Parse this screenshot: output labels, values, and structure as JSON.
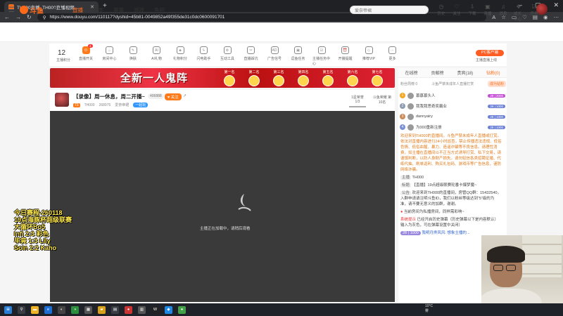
{
  "browser": {
    "tab_title": "TH000直播_TH000直播视频...",
    "url": "https://www.douyu.com/110117?dyshid=45b81-0049852a49f355de31c0dc0600091701"
  },
  "site": {
    "logo_text": "斗鱼",
    "nav": [
      "首页",
      "直播",
      "分类",
      "赛事",
      "游戏",
      "鱼吧"
    ],
    "search_placeholder": "爱奈帝裙",
    "header_icons": [
      "历史",
      "关注",
      "下载",
      "开播",
      "消息",
      "成长中心",
      "任务"
    ]
  },
  "toolbar": {
    "count": "12",
    "count_label": "主播积分",
    "items": [
      "直播开关",
      "房间中心",
      "换肤",
      "AI礼物",
      "礼物积分",
      "闪电助手",
      "互动工具",
      "直播踩坑",
      "广告信号",
      "逗鱼任务",
      "主播任务中心",
      "开播提醒",
      "推荐VIP",
      "更多"
    ],
    "badge": "4",
    "pc_button": "PC客户端",
    "pc_sub": "主播直播上线"
  },
  "banner": {
    "headline": "全新一人鬼阵",
    "ranks": [
      "第一名",
      "第二名",
      "第三名",
      "第四名",
      "第五名",
      "第六名",
      "第七名"
    ]
  },
  "streamer": {
    "title": "【录像】周一休息，周二开播~",
    "hot": "406888",
    "follow": "关注",
    "level": "73",
    "name": "TH000",
    "followers": "268975",
    "category": "爱奈帝裙",
    "tag": "一起玩",
    "rank_box": "1星荣誉 1/3",
    "rank_box2": "斗鱼荣耀 第10名"
  },
  "video": {
    "message": "主播正在加载中，请稍后观看"
  },
  "overlay": {
    "lines": [
      "今日赛程-260118",
      "19点海豚杯超级联赛",
      "大循环Bo5",
      "Infi 2:3 彩色",
      "毕竟 1:3 Lily",
      "Soin 2:2 Kaho"
    ]
  },
  "right_panel": {
    "tabs": [
      "在线榜",
      "贡献榜",
      "贵宾(18)",
      "钻粉(0)"
    ],
    "sub_left": "粉丝周榜 0",
    "sub_mid": "斗鱼严禁未成年人直播打赏",
    "sub_btn": "成为钻粉",
    "ranks": [
      {
        "no": "1",
        "name": "慕慕慕头人",
        "badge": "29 | 3000"
      },
      {
        "no": "2",
        "name": "我我我思奇奕霸业",
        "badge": "29 | 1000"
      },
      {
        "no": "3",
        "name": "dannyairy",
        "badge": "28 | 1000"
      },
      {
        "no": "4",
        "name": "为000重新注册",
        "badge": "28 | 1000"
      }
    ],
    "system_notice": "欢迎来到TH000的直播间。斗鱼严禁未成年人直播或打赏。依法对直播内容进行24小时巡查，禁止传播违法违规、低俗色情、低俗血腥、暴力、造谣诈骗等不良信息。请理性消费，如主播在直播间以不正当方式诱导打赏、私下交易，请谨慎判断，以防人身财产损失。请勿轻信各类招聘征婚、代练代抽、刷单返利、购买礼包码、游戏币等广告信息，谨防网络诈骗。",
    "host_label": "主播",
    "host_name": "TH000",
    "title_label": "标题",
    "title_text": "【直播】19点超级联赛轮番卡爆梦魔~",
    "notice_label": "公告",
    "notice_text": "欢迎来到TH000的直播间，房管QQ群：15432540，入群申请请注明斗鱼ID，我们以粉丝等级达到“5”级的为准，请不要无意义的加群，谢谢。",
    "line1": "当前房间为私播房间，同样需彩响~",
    "line2_label": "系统提示",
    "line2": "已经开启历史弹幕（历史弹幕以下是内容默认）输入为灰色，可在弹幕设置中关闭）",
    "line3_level": "28 | 1000",
    "line3": "我明月搀风风: 想象主播的..."
  },
  "taskbar": {
    "weather_temp": "10°C",
    "weather_desc": "雾"
  }
}
